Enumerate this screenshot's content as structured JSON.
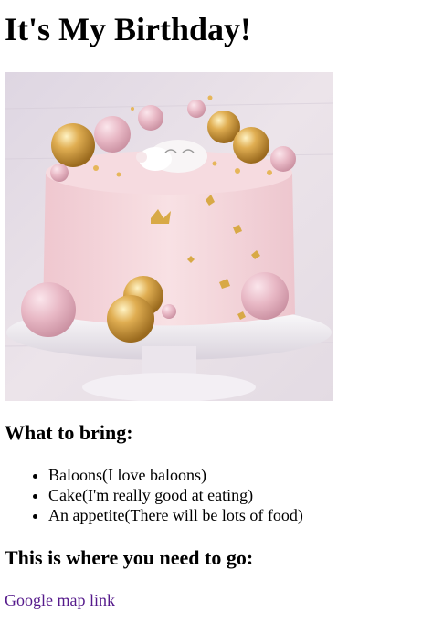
{
  "page": {
    "title": "It's My Birthday!"
  },
  "image": {
    "subject": "birthday-cake-photo",
    "colors": {
      "backdrop": "#e9dfe6",
      "frosting": "#f3d9de",
      "gold": "#d4a24a",
      "pink_ball": "#e7b9c5",
      "stand": "#f4f1f4"
    }
  },
  "bring": {
    "heading": "What to bring:",
    "items": [
      "Baloons(I love baloons)",
      "Cake(I'm really good at eating)",
      "An appetite(There will be lots of food)"
    ]
  },
  "go": {
    "heading": "This is where you need to go:",
    "link_text": "Google map link"
  },
  "colors": {
    "visited_link": "#551a8b"
  }
}
